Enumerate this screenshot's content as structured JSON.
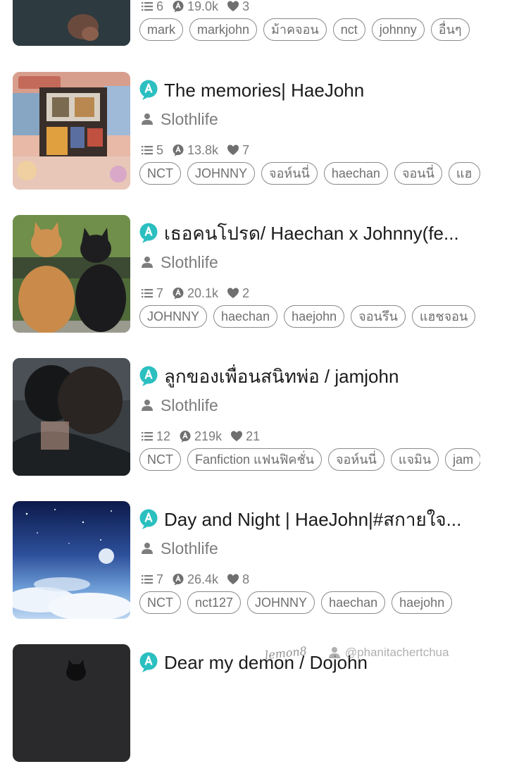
{
  "stories": [
    {
      "title": "",
      "author": "",
      "stats": {
        "parts": "6",
        "reads": "19.0k",
        "votes": "3"
      },
      "tags": [
        "mark",
        "markjohn",
        "ม้าคจอน",
        "nct",
        "johnny",
        "อื่นๆ"
      ]
    },
    {
      "title": "The memories| HaeJohn",
      "author": "Slothlife",
      "stats": {
        "parts": "5",
        "reads": "13.8k",
        "votes": "7"
      },
      "tags": [
        "NCT",
        "JOHNNY",
        "จอห์นนี่",
        "haechan",
        "จอนนี่",
        "แฮ"
      ]
    },
    {
      "title": "เธอคนโปรด/ Haechan x Johnny(fe...",
      "author": "Slothlife",
      "stats": {
        "parts": "7",
        "reads": "20.1k",
        "votes": "2"
      },
      "tags": [
        "JOHNNY",
        "haechan",
        "haejohn",
        "จอนรึน",
        "แฮชจอน"
      ]
    },
    {
      "title": "ลูกของเพื่อนสนิทพ่อ / jamjohn",
      "author": "Slothlife",
      "stats": {
        "parts": "12",
        "reads": "219k",
        "votes": "21"
      },
      "tags": [
        "NCT",
        "Fanfiction แฟนฟิคชั่น",
        "จอห์นนี่",
        "แจมิน",
        "jam"
      ]
    },
    {
      "title": "Day and Night | HaeJohn|#สกายใจ...",
      "author": "Slothlife",
      "stats": {
        "parts": "7",
        "reads": "26.4k",
        "votes": "8"
      },
      "tags": [
        "NCT",
        "nct127",
        "JOHNNY",
        "haechan",
        "haejohn"
      ]
    },
    {
      "title": "Dear my demon / Dojohn",
      "author": "",
      "stats": {
        "parts": "",
        "reads": "",
        "votes": ""
      },
      "tags": []
    }
  ],
  "watermark": {
    "logo": "lemon8",
    "user": "@phanitachertchua"
  },
  "colors": {
    "badge": "#2bbfc0",
    "muted_text": "#7d7d7d",
    "tag_border": "#8a8a8a"
  },
  "icons": {
    "badge": "wattpad-a-badge-icon",
    "author": "user-icon",
    "parts": "list-icon",
    "reads": "read-count-icon",
    "votes": "heart-icon"
  }
}
